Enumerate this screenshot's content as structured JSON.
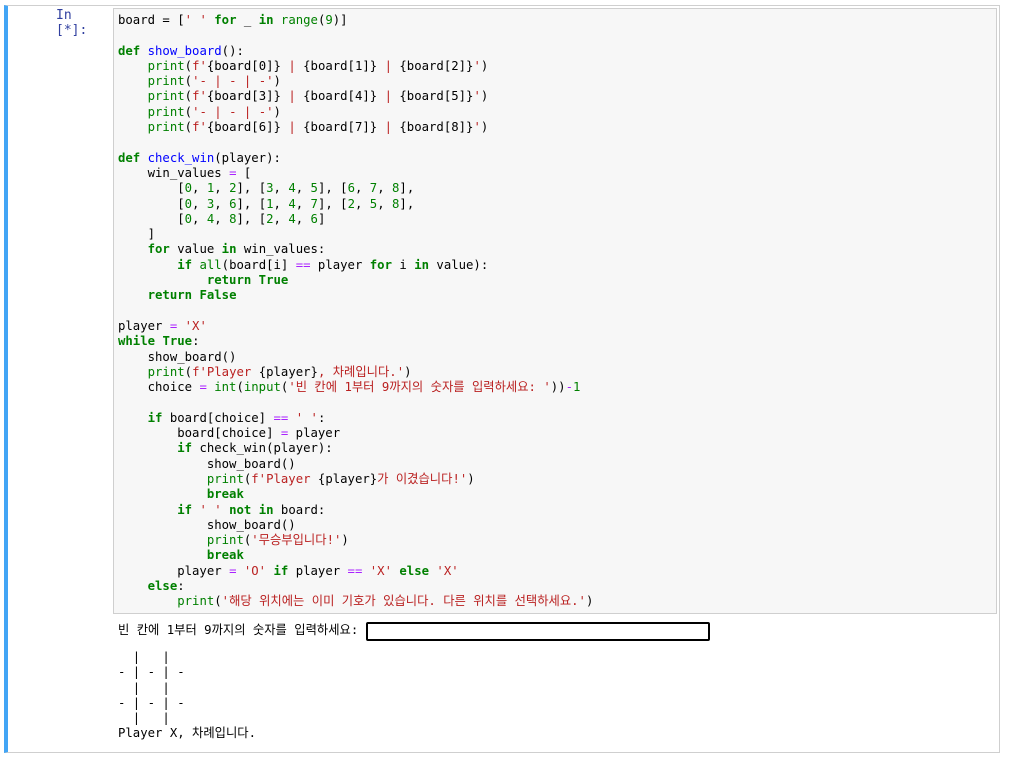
{
  "cell": {
    "prompt": "In [*]:",
    "code_lines": [
      [
        [
          "board = [",
          ""
        ],
        [
          "' '",
          "str"
        ],
        [
          " ",
          ""
        ],
        [
          "for",
          "kw"
        ],
        [
          " _ ",
          ""
        ],
        [
          "in",
          "kw"
        ],
        [
          " ",
          ""
        ],
        [
          "range",
          "bi"
        ],
        [
          "(",
          ""
        ],
        [
          "9",
          "num"
        ],
        [
          ")]",
          ""
        ]
      ],
      [],
      [
        [
          "def",
          "kw"
        ],
        [
          " ",
          ""
        ],
        [
          "show_board",
          "fn"
        ],
        [
          "():",
          ""
        ]
      ],
      [
        [
          "    ",
          ""
        ],
        [
          "print",
          "bi"
        ],
        [
          "(",
          ""
        ],
        [
          "f'",
          "str"
        ],
        [
          "{board[0]}",
          ""
        ],
        [
          " | ",
          "str"
        ],
        [
          "{board[1]}",
          ""
        ],
        [
          " | ",
          "str"
        ],
        [
          "{board[2]}",
          ""
        ],
        [
          "'",
          "str"
        ],
        [
          ")",
          ""
        ]
      ],
      [
        [
          "    ",
          ""
        ],
        [
          "print",
          "bi"
        ],
        [
          "(",
          ""
        ],
        [
          "'- | - | -'",
          "str"
        ],
        [
          ")",
          ""
        ]
      ],
      [
        [
          "    ",
          ""
        ],
        [
          "print",
          "bi"
        ],
        [
          "(",
          ""
        ],
        [
          "f'",
          "str"
        ],
        [
          "{board[3]}",
          ""
        ],
        [
          " | ",
          "str"
        ],
        [
          "{board[4]}",
          ""
        ],
        [
          " | ",
          "str"
        ],
        [
          "{board[5]}",
          ""
        ],
        [
          "'",
          "str"
        ],
        [
          ")",
          ""
        ]
      ],
      [
        [
          "    ",
          ""
        ],
        [
          "print",
          "bi"
        ],
        [
          "(",
          ""
        ],
        [
          "'- | - | -'",
          "str"
        ],
        [
          ")",
          ""
        ]
      ],
      [
        [
          "    ",
          ""
        ],
        [
          "print",
          "bi"
        ],
        [
          "(",
          ""
        ],
        [
          "f'",
          "str"
        ],
        [
          "{board[6]}",
          ""
        ],
        [
          " | ",
          "str"
        ],
        [
          "{board[7]}",
          ""
        ],
        [
          " | ",
          "str"
        ],
        [
          "{board[8]}",
          ""
        ],
        [
          "'",
          "str"
        ],
        [
          ")",
          ""
        ]
      ],
      [],
      [
        [
          "def",
          "kw"
        ],
        [
          " ",
          ""
        ],
        [
          "check_win",
          "fn"
        ],
        [
          "(player):",
          ""
        ]
      ],
      [
        [
          "    win_values ",
          ""
        ],
        [
          "=",
          "op"
        ],
        [
          " [",
          ""
        ]
      ],
      [
        [
          "        [",
          ""
        ],
        [
          "0",
          "num"
        ],
        [
          ", ",
          ""
        ],
        [
          "1",
          "num"
        ],
        [
          ", ",
          ""
        ],
        [
          "2",
          "num"
        ],
        [
          "], [",
          ""
        ],
        [
          "3",
          "num"
        ],
        [
          ", ",
          ""
        ],
        [
          "4",
          "num"
        ],
        [
          ", ",
          ""
        ],
        [
          "5",
          "num"
        ],
        [
          "], [",
          ""
        ],
        [
          "6",
          "num"
        ],
        [
          ", ",
          ""
        ],
        [
          "7",
          "num"
        ],
        [
          ", ",
          ""
        ],
        [
          "8",
          "num"
        ],
        [
          "],",
          ""
        ]
      ],
      [
        [
          "        [",
          ""
        ],
        [
          "0",
          "num"
        ],
        [
          ", ",
          ""
        ],
        [
          "3",
          "num"
        ],
        [
          ", ",
          ""
        ],
        [
          "6",
          "num"
        ],
        [
          "], [",
          ""
        ],
        [
          "1",
          "num"
        ],
        [
          ", ",
          ""
        ],
        [
          "4",
          "num"
        ],
        [
          ", ",
          ""
        ],
        [
          "7",
          "num"
        ],
        [
          "], [",
          ""
        ],
        [
          "2",
          "num"
        ],
        [
          ", ",
          ""
        ],
        [
          "5",
          "num"
        ],
        [
          ", ",
          ""
        ],
        [
          "8",
          "num"
        ],
        [
          "],",
          ""
        ]
      ],
      [
        [
          "        [",
          ""
        ],
        [
          "0",
          "num"
        ],
        [
          ", ",
          ""
        ],
        [
          "4",
          "num"
        ],
        [
          ", ",
          ""
        ],
        [
          "8",
          "num"
        ],
        [
          "], [",
          ""
        ],
        [
          "2",
          "num"
        ],
        [
          ", ",
          ""
        ],
        [
          "4",
          "num"
        ],
        [
          ", ",
          ""
        ],
        [
          "6",
          "num"
        ],
        [
          "]",
          ""
        ]
      ],
      [
        [
          "    ]",
          ""
        ]
      ],
      [
        [
          "    ",
          ""
        ],
        [
          "for",
          "kw"
        ],
        [
          " value ",
          ""
        ],
        [
          "in",
          "kw"
        ],
        [
          " win_values:",
          ""
        ]
      ],
      [
        [
          "        ",
          ""
        ],
        [
          "if",
          "kw"
        ],
        [
          " ",
          ""
        ],
        [
          "all",
          "bi"
        ],
        [
          "(board[i] ",
          ""
        ],
        [
          "==",
          "op"
        ],
        [
          " player ",
          ""
        ],
        [
          "for",
          "kw"
        ],
        [
          " i ",
          ""
        ],
        [
          "in",
          "kw"
        ],
        [
          " value):",
          ""
        ]
      ],
      [
        [
          "            ",
          ""
        ],
        [
          "return",
          "kw"
        ],
        [
          " ",
          ""
        ],
        [
          "True",
          "kw"
        ]
      ],
      [
        [
          "    ",
          ""
        ],
        [
          "return",
          "kw"
        ],
        [
          " ",
          ""
        ],
        [
          "False",
          "kw"
        ]
      ],
      [],
      [
        [
          "player ",
          ""
        ],
        [
          "=",
          "op"
        ],
        [
          " ",
          ""
        ],
        [
          "'X'",
          "str"
        ]
      ],
      [
        [
          "while",
          "kw"
        ],
        [
          " ",
          ""
        ],
        [
          "True",
          "kw"
        ],
        [
          ":",
          ""
        ]
      ],
      [
        [
          "    show_board()",
          ""
        ]
      ],
      [
        [
          "    ",
          ""
        ],
        [
          "print",
          "bi"
        ],
        [
          "(",
          ""
        ],
        [
          "f'Player ",
          "str"
        ],
        [
          "{player}",
          ""
        ],
        [
          ", 차례입니다.'",
          "str"
        ],
        [
          ")",
          ""
        ]
      ],
      [
        [
          "    choice ",
          ""
        ],
        [
          "=",
          "op"
        ],
        [
          " ",
          ""
        ],
        [
          "int",
          "bi"
        ],
        [
          "(",
          ""
        ],
        [
          "input",
          "bi"
        ],
        [
          "(",
          ""
        ],
        [
          "'빈 칸에 1부터 9까지의 숫자를 입력하세요: '",
          "str"
        ],
        [
          ")",
          ""
        ],
        [
          ")",
          ""
        ],
        [
          "-",
          "op"
        ],
        [
          "1",
          "num"
        ]
      ],
      [],
      [
        [
          "    ",
          ""
        ],
        [
          "if",
          "kw"
        ],
        [
          " board[choice] ",
          ""
        ],
        [
          "==",
          "op"
        ],
        [
          " ",
          ""
        ],
        [
          "' '",
          "str"
        ],
        [
          ":",
          ""
        ]
      ],
      [
        [
          "        board[choice] ",
          ""
        ],
        [
          "=",
          "op"
        ],
        [
          " player",
          ""
        ]
      ],
      [
        [
          "        ",
          ""
        ],
        [
          "if",
          "kw"
        ],
        [
          " check_win(player):",
          ""
        ]
      ],
      [
        [
          "            show_board()",
          ""
        ]
      ],
      [
        [
          "            ",
          ""
        ],
        [
          "print",
          "bi"
        ],
        [
          "(",
          ""
        ],
        [
          "f'Player ",
          "str"
        ],
        [
          "{player}",
          ""
        ],
        [
          "가 이겼습니다!'",
          "str"
        ],
        [
          ")",
          ""
        ]
      ],
      [
        [
          "            ",
          ""
        ],
        [
          "break",
          "kw"
        ]
      ],
      [
        [
          "        ",
          ""
        ],
        [
          "if",
          "kw"
        ],
        [
          " ",
          ""
        ],
        [
          "' '",
          "str"
        ],
        [
          " ",
          ""
        ],
        [
          "not",
          "kw"
        ],
        [
          " ",
          ""
        ],
        [
          "in",
          "kw"
        ],
        [
          " board:",
          ""
        ]
      ],
      [
        [
          "            show_board()",
          ""
        ]
      ],
      [
        [
          "            ",
          ""
        ],
        [
          "print",
          "bi"
        ],
        [
          "(",
          ""
        ],
        [
          "'무승부입니다!'",
          "str"
        ],
        [
          ")",
          ""
        ]
      ],
      [
        [
          "            ",
          ""
        ],
        [
          "break",
          "kw"
        ]
      ],
      [
        [
          "        player ",
          ""
        ],
        [
          "=",
          "op"
        ],
        [
          " ",
          ""
        ],
        [
          "'O'",
          "str"
        ],
        [
          " ",
          ""
        ],
        [
          "if",
          "kw"
        ],
        [
          " player ",
          ""
        ],
        [
          "==",
          "op"
        ],
        [
          " ",
          ""
        ],
        [
          "'X'",
          "str"
        ],
        [
          " ",
          ""
        ],
        [
          "else",
          "kw"
        ],
        [
          " ",
          ""
        ],
        [
          "'X'",
          "str"
        ]
      ],
      [
        [
          "    ",
          ""
        ],
        [
          "else",
          "kw"
        ],
        [
          ":",
          ""
        ]
      ],
      [
        [
          "        ",
          ""
        ],
        [
          "print",
          "bi"
        ],
        [
          "(",
          ""
        ],
        [
          "'해당 위치에는 이미 기호가 있습니다. 다른 위치를 선택하세요.'",
          "str"
        ],
        [
          ")",
          ""
        ]
      ]
    ]
  },
  "output": {
    "stdin_prompt": "빈 칸에 1부터 9까지의 숫자를 입력하세요:",
    "stdin_value": "",
    "stdout": "  |   |  \n- | - | -\n  |   |  \n- | - | -\n  |   |  \nPlayer X, 차례입니다."
  }
}
